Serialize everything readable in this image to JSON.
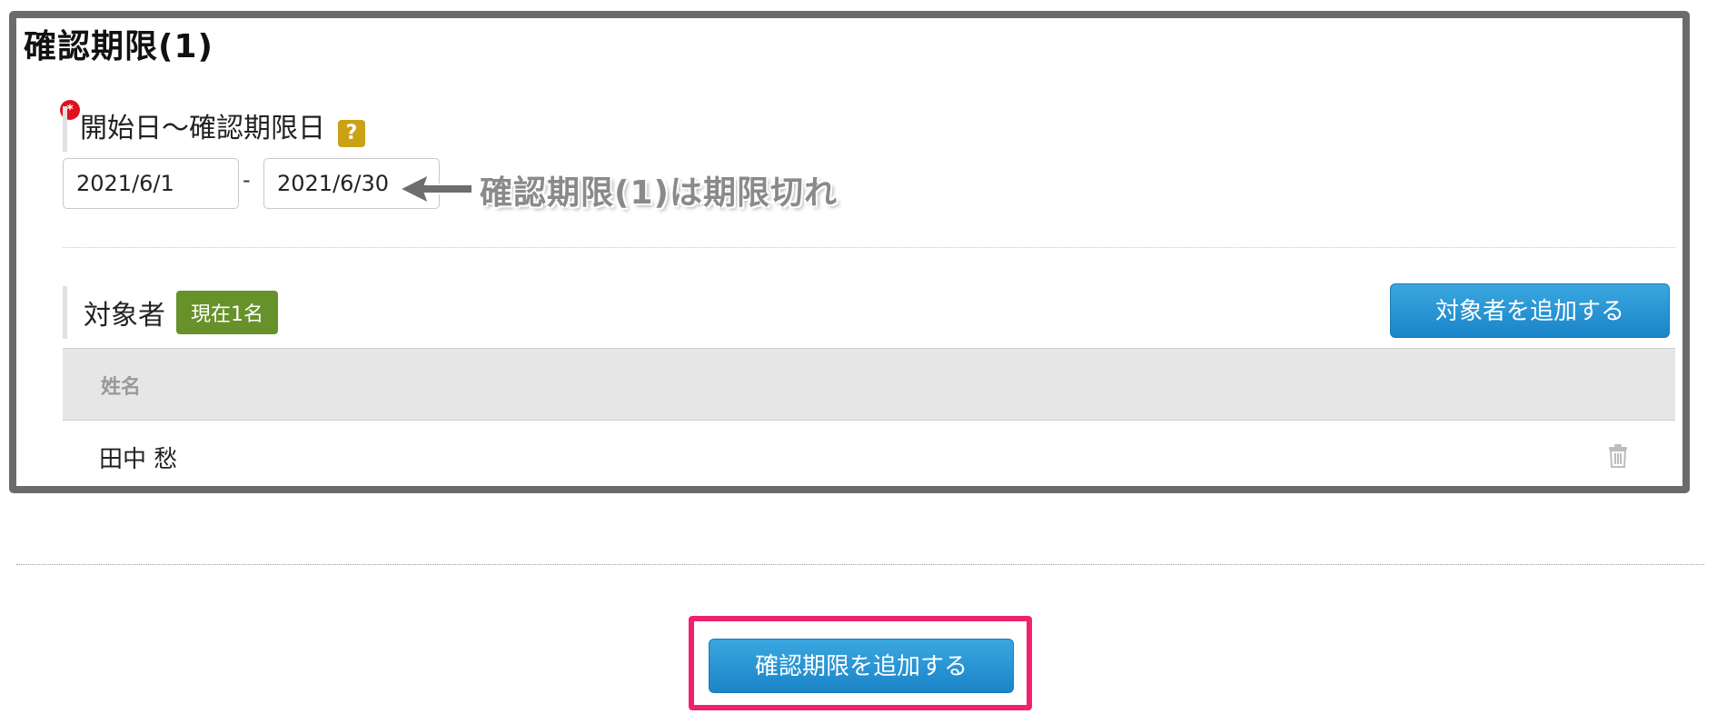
{
  "section": {
    "title": "確認期限(1)"
  },
  "period_field": {
    "required_mark": "*",
    "label": "開始日〜確認期限日",
    "help_badge": "?",
    "start_date": "2021/6/1",
    "separator": "-",
    "end_date": "2021/6/30"
  },
  "annotation": {
    "text": "確認期限(1)は期限切れ"
  },
  "targets": {
    "label": "対象者",
    "count_badge": "現在1名",
    "add_button": "対象者を追加する",
    "table": {
      "columns": [
        "姓名"
      ],
      "rows": [
        {
          "name": "田中 愁"
        }
      ]
    }
  },
  "footer": {
    "add_period_button": "確認期限を追加する"
  },
  "colors": {
    "button_blue": "#2a96d6",
    "badge_green": "#67912a",
    "help_yellow": "#c9a215",
    "required_red": "#e0101c",
    "highlight_pink": "#f0226e",
    "frame_gray": "#6b6b6b"
  }
}
